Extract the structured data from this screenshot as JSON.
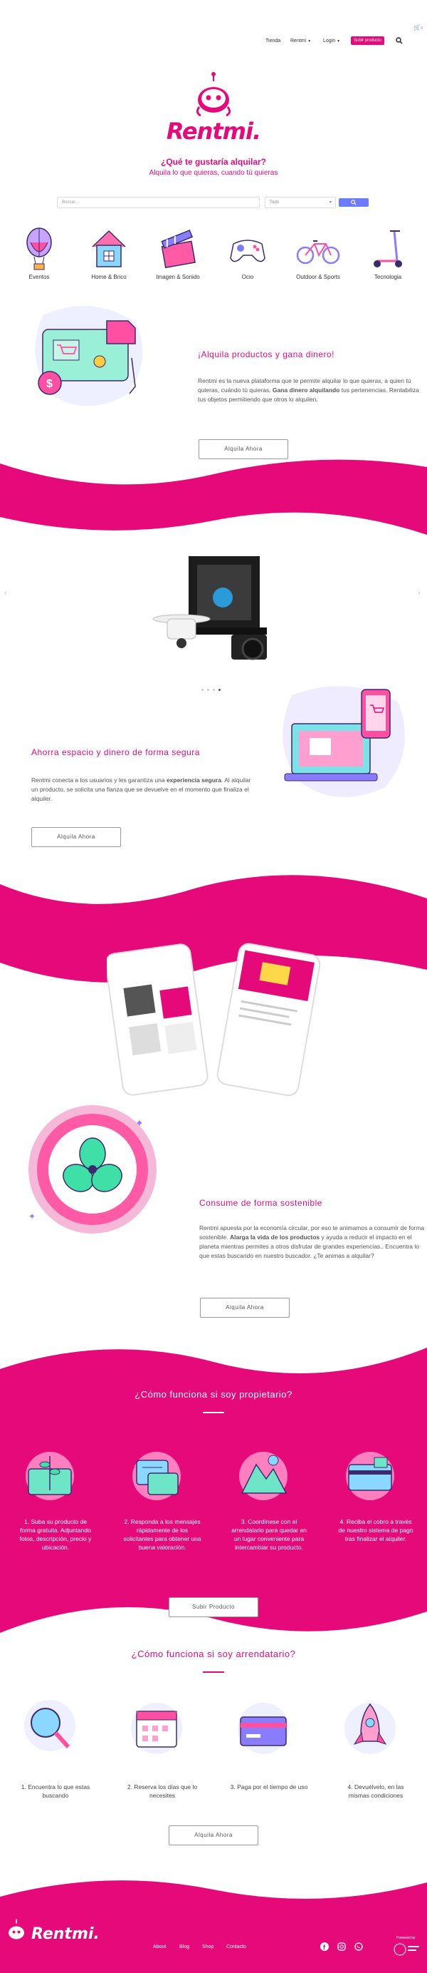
{
  "colors": {
    "brand": "#e6097a",
    "accent": "#6b7cff"
  },
  "header": {
    "cart_count": "0",
    "nav": [
      {
        "label": "Tienda"
      },
      {
        "label": "Rentmi"
      },
      {
        "label": "Login"
      }
    ],
    "cta_label": "Subir producto",
    "search_icon": "search-icon"
  },
  "hero": {
    "brand": "Rentmi.",
    "title": "¿Qué te gustaría alquilar?",
    "subtitle": "Alquila lo que quieras, cuando tú quieras",
    "search_placeholder": "Buscar...",
    "category_select": "Todo",
    "search_button_icon": "search-icon"
  },
  "categories": [
    {
      "label": "Eventos",
      "icon": "balloon-icon"
    },
    {
      "label": "Home & Brico",
      "icon": "house-icon"
    },
    {
      "label": "Imagen & Sonido",
      "icon": "clapperboard-icon"
    },
    {
      "label": "Ocio",
      "icon": "gamepad-icon"
    },
    {
      "label": "Outdoor & Sports",
      "icon": "bicycle-icon"
    },
    {
      "label": "Tecnologia",
      "icon": "scooter-icon"
    }
  ],
  "section1": {
    "title": "¡Alquila productos y gana dinero!",
    "text_a": "Rentmi es la nueva plataforma que te permite alquilar lo que quieras, a quien tú quieras, cuándo tú quieras. ",
    "text_bold": "Gana dinero alquilando",
    "text_b": " tus pertenencias. Rentabiliza tus objetos  permitiendo que otros lo alquilen.",
    "button": "Alquila Ahora"
  },
  "slider": {
    "dots": 4,
    "active_dot": 4,
    "prev_icon": "chevron-left-icon",
    "next_icon": "chevron-right-icon"
  },
  "section2": {
    "title": "Ahorra espacio y dinero de forma segura",
    "text_a": "Rentmi conecta a los usuarios y les garantiza una ",
    "text_bold": "experiencia segura",
    "text_b": ". Al alquilar un producto, se solicita una fianza que se devuelve en el momento que finaliza el alquiler.",
    "button": "Alquila Ahora"
  },
  "section3": {
    "title": "Consume de forma sostenible",
    "text_a": "Rentmi apuesta por la economía circular, por eso te animamos a consumir de forma sostenible. ",
    "text_bold": "Alarga la vida de los productos",
    "text_b": " y ayuda a reducir el impacto en el planeta mientras permites a otros disfrutar de grandes experiencias.. Encuentra lo que estas buscando en nuestro buscador. ¿Te animas a alquilar?",
    "button": "Alquila Ahora"
  },
  "owner": {
    "title": "¿Cómo funciona si soy propietario?",
    "steps": [
      "1. Suba su producto de forma gratuita. Adjuntando fotos, descripción, precio y ubicación.",
      "2. Responda a los mensajes rápidamente de los solicitantes para obtener una buena valoración.",
      "3. Coordínese con el arrendatario para quedar en un lugar conveniente para intercambiar su producto.",
      "4. Reciba el cobro a través de nuestro sistema de pago tras finalizar el alquiler."
    ],
    "button": "Subir Producto"
  },
  "renter": {
    "title": "¿Cómo funciona si soy arrendatario?",
    "steps": [
      "1. Encuentra lo que estas buscando",
      "2. Reserva los días que lo necesites",
      "3. Paga por el tiempo de uso",
      "4. Devuélvelo, en las mismas condiciones"
    ],
    "button": "Alquila Ahora"
  },
  "footer": {
    "brand": "Rentmi.",
    "links": [
      "About",
      "Blog",
      "Shop",
      "Contacto"
    ],
    "social": [
      "facebook-icon",
      "instagram-icon",
      "whatsapp-icon"
    ],
    "powered": "Powered by"
  }
}
